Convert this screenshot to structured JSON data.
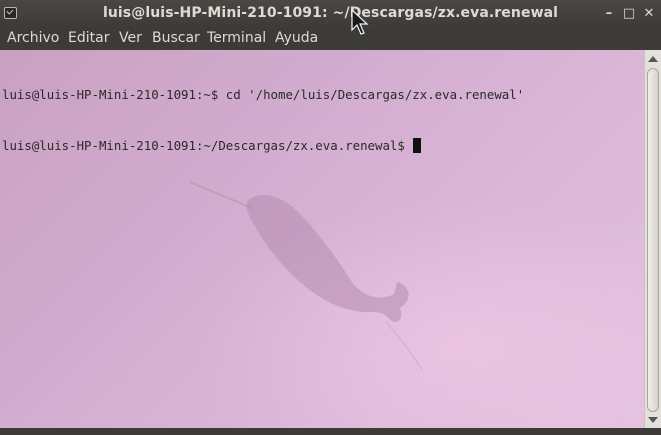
{
  "window": {
    "title": "luis@luis-HP-Mini-210-1091: ~/Descargas/zx.eva.renewal",
    "buttons": {
      "minimize": "–",
      "maximize": "□",
      "close": "✕"
    }
  },
  "menu": {
    "items": [
      {
        "label": "Archivo"
      },
      {
        "label": "Editar"
      },
      {
        "label": "Ver"
      },
      {
        "label": "Buscar"
      },
      {
        "label": "Terminal"
      },
      {
        "label": "Ayuda"
      }
    ]
  },
  "terminal": {
    "lines": [
      "luis@luis-HP-Mini-210-1091:~$ cd '/home/luis/Descargas/zx.eva.renewal'",
      "luis@luis-HP-Mini-210-1091:~/Descargas/zx.eva.renewal$ "
    ]
  },
  "scrollbar": {
    "position": 0
  },
  "icons": {
    "app": "terminal-icon",
    "minimize": "minimize-icon",
    "maximize": "maximize-icon",
    "close": "close-icon",
    "pointer": "mouse-pointer-icon"
  },
  "colors": {
    "titlebar": "#3c3b37",
    "title_text": "#dfdbd2",
    "terminal_bg": "#d3aed0",
    "terminal_text": "#2a2a2a"
  }
}
